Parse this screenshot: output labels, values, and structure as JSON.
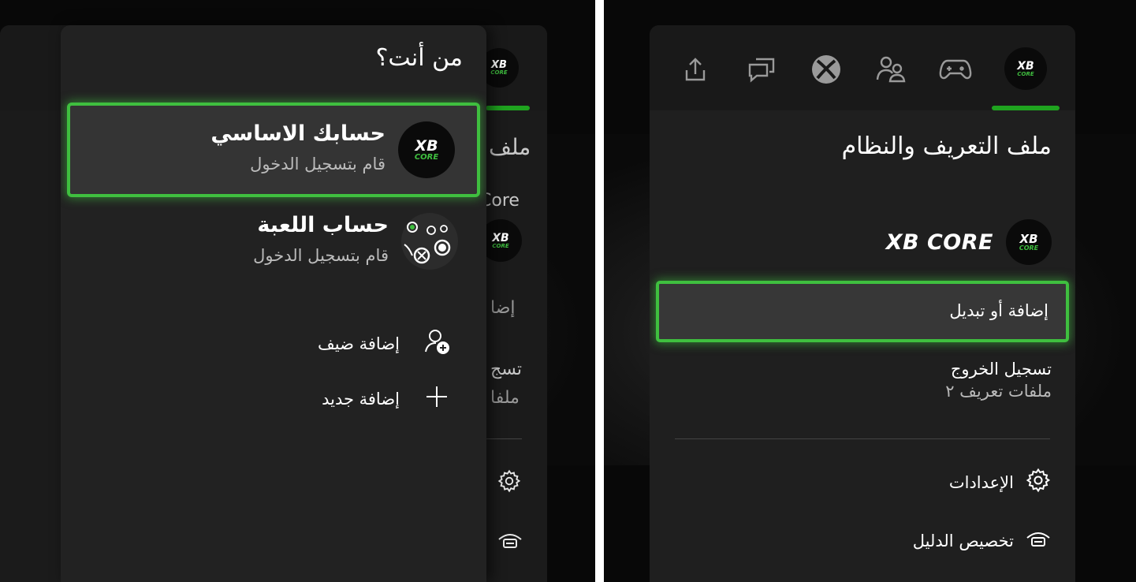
{
  "right_panel": {
    "title": "ملف التعريف والنظام",
    "gamertag": "XB CORE",
    "logo": {
      "line1": "XB",
      "line2": "CORE"
    },
    "tabs": [
      "profile-icon",
      "controller-icon",
      "people-icon",
      "xbox-icon",
      "chat-icon",
      "share-icon"
    ],
    "menu": {
      "add_switch": "إضافة أو تبديل",
      "sign_out": "تسجيل الخروج",
      "sign_out_sub": "ملفات تعريف ٢",
      "settings": "الإعدادات",
      "customize_guide": "تخصيص الدليل"
    },
    "accent_color": "#3fbf3f"
  },
  "left_panel": {
    "who_title": "من أنت؟",
    "accounts": [
      {
        "name": "حسابك الاساسي",
        "status": "قام بتسجيل الدخول"
      },
      {
        "name": "حساب اللعبة",
        "status": "قام بتسجيل الدخول"
      }
    ],
    "add_guest": "إضافة ضيف",
    "add_new": "إضافة جديد",
    "background_fragments": {
      "title": "ملف",
      "core": "Core",
      "add": "إضا",
      "signout": "تسج",
      "profiles": "ملفا"
    }
  }
}
